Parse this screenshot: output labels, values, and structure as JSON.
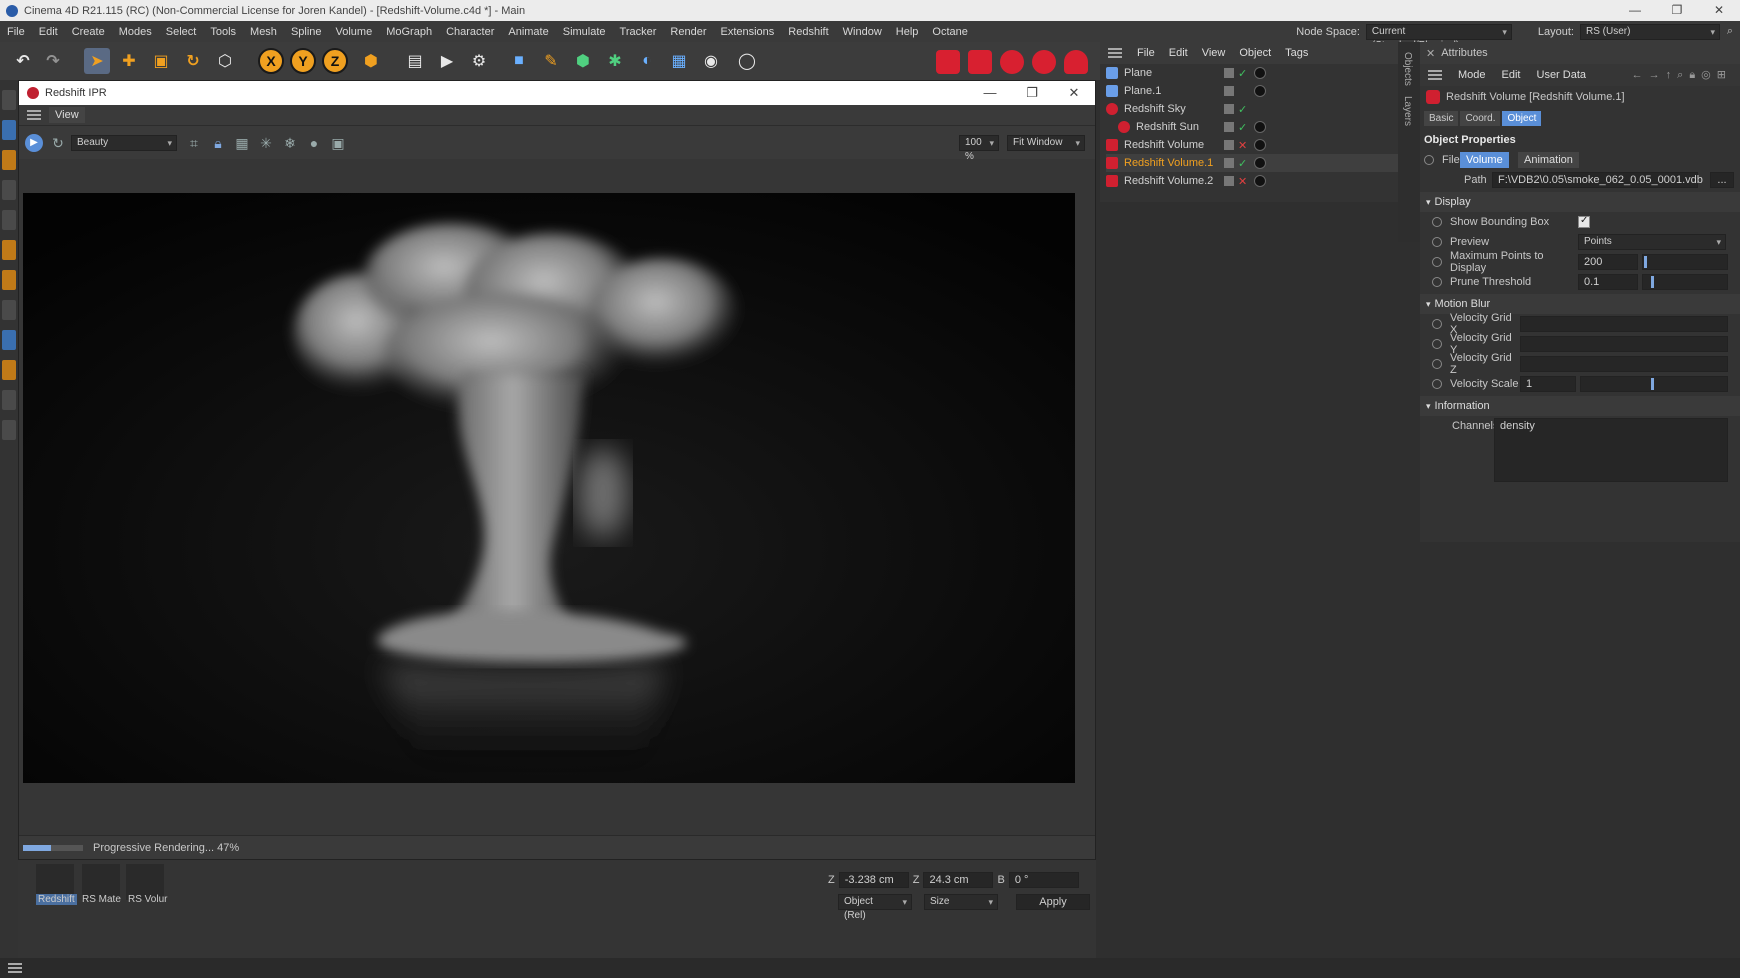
{
  "window": {
    "title": "Cinema 4D R21.115 (RC) (Non-Commercial License for Joren Kandel) - [Redshift-Volume.c4d *] - Main",
    "controls": [
      "—",
      "❐",
      "✕"
    ]
  },
  "menubar": {
    "items": [
      "File",
      "Edit",
      "Create",
      "Modes",
      "Select",
      "Tools",
      "Mesh",
      "Spline",
      "Volume",
      "MoGraph",
      "Character",
      "Animate",
      "Simulate",
      "Tracker",
      "Render",
      "Extensions",
      "Redshift",
      "Window",
      "Help",
      "Octane"
    ],
    "node_space_label": "Node Space:",
    "node_space_value": "Current (Standard/Physical)",
    "layout_label": "Layout:",
    "layout_value": "RS (User)"
  },
  "ipr": {
    "title": "Redshift IPR",
    "menu_view": "View",
    "aov": "Beauty",
    "zoom": "100 %",
    "fit": "Fit Window",
    "status_text": "Progressive Rendering... 47%",
    "progress": 0.47
  },
  "objects": {
    "menu": [
      "File",
      "Edit",
      "View",
      "Object",
      "Tags"
    ],
    "rows": [
      {
        "name": "Plane",
        "color": "#6a9ee8"
      },
      {
        "name": "Plane.1",
        "color": "#6a9ee8"
      },
      {
        "name": "Redshift Sky",
        "color": "#d02030"
      },
      {
        "name": "Redshift Sun",
        "color": "#d02030"
      },
      {
        "name": "Redshift Volume",
        "color": "#d02030"
      },
      {
        "name": "Redshift Volume.1",
        "color": "#d02030"
      },
      {
        "name": "Redshift Volume.2",
        "color": "#d02030"
      }
    ],
    "side_tabs": [
      "Objects",
      "Layers"
    ]
  },
  "attributes": {
    "title": "Attributes",
    "menu": [
      "Mode",
      "Edit",
      "User Data"
    ],
    "object_name": "Redshift Volume [Redshift Volume.1]",
    "tabs": [
      "Basic",
      "Coord.",
      "Object"
    ],
    "section_title": "Object Properties",
    "file_label": "File",
    "file_tabs": [
      "Volume",
      "Animation"
    ],
    "path_label": "Path",
    "path_value": "F:\\VDB2\\0.05\\smoke_062_0.05_0001.vdb",
    "path_button": "...",
    "display": {
      "header": "Display",
      "show_bbox": "Show Bounding Box",
      "preview_label": "Preview",
      "preview_value": "Points",
      "max_points_label": "Maximum Points to Display",
      "max_points_value": "200",
      "prune_label": "Prune Threshold",
      "prune_value": "0.1"
    },
    "motion_blur": {
      "header": "Motion Blur",
      "grid_x": "Velocity Grid X",
      "grid_y": "Velocity Grid Y",
      "grid_z": "Velocity Grid Z",
      "scale_label": "Velocity Scale",
      "scale_value": "1"
    },
    "information": {
      "header": "Information",
      "channels_label": "Channels",
      "channels_value": "density"
    }
  },
  "bottom": {
    "materials": [
      "Redshift",
      "RS Mate",
      "RS Volur"
    ],
    "coords": {
      "z_pos": "-3.238 cm",
      "z_size": "24.3 cm",
      "b_rot": "0 °",
      "axis_z": "Z",
      "axis_b": "B",
      "mode": "Object (Rel)",
      "size_mode": "Size",
      "apply": "Apply"
    }
  }
}
